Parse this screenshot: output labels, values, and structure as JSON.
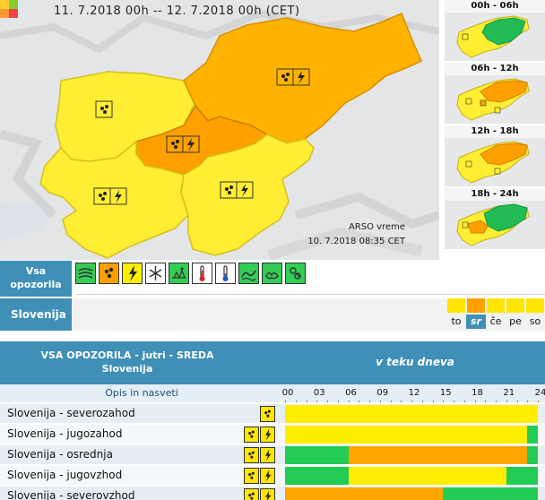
{
  "map": {
    "title": "11. 7.2018  00h  --  12. 7.2018  00h    (CET)",
    "credit_source": "ARSO vreme",
    "credit_time": "10. 7.2018  08:35 CET",
    "legend_colors": [
      "#ffcc33",
      "#88cc33",
      "#ff9933",
      "#ee4444"
    ],
    "regions": [
      {
        "name": "severozahod",
        "color": "#ffee33",
        "icons": [
          "rain"
        ]
      },
      {
        "name": "severovzhod",
        "color": "#ffb300",
        "icons": [
          "rain",
          "thunderstorm"
        ]
      },
      {
        "name": "osrednja",
        "color": "#ffa000",
        "icons": [
          "rain",
          "thunderstorm"
        ]
      },
      {
        "name": "jugozahod",
        "color": "#ffee33",
        "icons": [
          "rain",
          "thunderstorm"
        ]
      },
      {
        "name": "jugovzhod",
        "color": "#ffee33",
        "icons": [
          "rain",
          "thunderstorm"
        ]
      }
    ]
  },
  "periods": [
    {
      "label": "00h - 06h"
    },
    {
      "label": "06h - 12h"
    },
    {
      "label": "12h - 18h"
    },
    {
      "label": "18h - 24h"
    }
  ],
  "toolbar": {
    "type_label_1": "Vsa",
    "type_label_2": "opozorila",
    "icons": [
      {
        "name": "wind-icon",
        "color": "#33cc55"
      },
      {
        "name": "rain-icon",
        "color": "#ffa000"
      },
      {
        "name": "thunderstorm-icon",
        "color": "#ffee00"
      },
      {
        "name": "snow-icon",
        "color": "#ffffff"
      },
      {
        "name": "ice-icon",
        "color": "#33cc55"
      },
      {
        "name": "heat-icon",
        "color": "#ffffff"
      },
      {
        "name": "cold-icon",
        "color": "#ffffff"
      },
      {
        "name": "coastal-icon",
        "color": "#33cc55"
      },
      {
        "name": "forest-fire-icon",
        "color": "#33cc55"
      },
      {
        "name": "fog-icon",
        "color": "#33cc55"
      }
    ],
    "region_label": "Slovenija",
    "days": [
      {
        "label": "to",
        "color": "#ffe600",
        "active": false
      },
      {
        "label": "sr",
        "color": "#ffa000",
        "active": true
      },
      {
        "label": "če",
        "color": "#ffe600",
        "active": false
      },
      {
        "label": "pe",
        "color": "#ffe600",
        "active": false
      },
      {
        "label": "so",
        "color": "#ffe600",
        "active": false
      }
    ]
  },
  "table": {
    "title": "VSA OPOZORILA - jutri - SREDA",
    "subtitle": "Slovenija",
    "day_header": "v teku dneva",
    "opis_label": "Opis in nasveti",
    "hours": [
      "00",
      "03",
      "06",
      "09",
      "12",
      "15",
      "18",
      "21",
      "24"
    ],
    "colors": {
      "green": "#22cc55",
      "yellow": "#ffee00",
      "orange": "#ffa500"
    },
    "rows": [
      {
        "name": "Slovenija - severozahod",
        "icons": [
          "rain"
        ],
        "segments": [
          {
            "end": 24,
            "color": "yellow"
          }
        ]
      },
      {
        "name": "Slovenija - jugozahod",
        "icons": [
          "rain",
          "thunderstorm"
        ],
        "segments": [
          {
            "end": 23,
            "color": "yellow"
          },
          {
            "end": 24,
            "color": "green"
          }
        ]
      },
      {
        "name": "Slovenija - osrednja",
        "icons": [
          "rain",
          "thunderstorm"
        ],
        "segments": [
          {
            "end": 6,
            "color": "green"
          },
          {
            "end": 23,
            "color": "orange"
          },
          {
            "end": 24,
            "color": "green"
          }
        ]
      },
      {
        "name": "Slovenija - jugovzhod",
        "icons": [
          "rain",
          "thunderstorm"
        ],
        "segments": [
          {
            "end": 6,
            "color": "green"
          },
          {
            "end": 21,
            "color": "yellow"
          },
          {
            "end": 24,
            "color": "green"
          }
        ]
      },
      {
        "name": "Slovenija - severovzhod",
        "icons": [
          "rain",
          "thunderstorm"
        ],
        "segments": [
          {
            "end": 15,
            "color": "orange"
          },
          {
            "end": 24,
            "color": "green"
          }
        ]
      }
    ]
  }
}
